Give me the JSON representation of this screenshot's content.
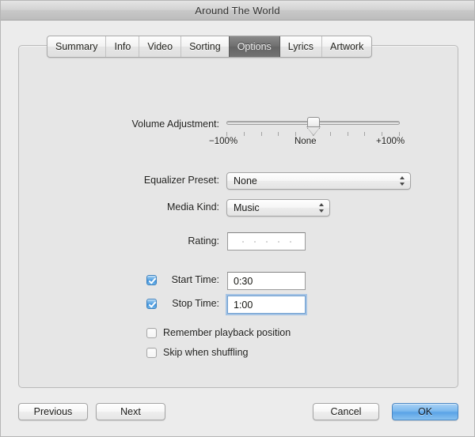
{
  "window": {
    "title": "Around The World"
  },
  "tabs": [
    {
      "label": "Summary",
      "selected": false
    },
    {
      "label": "Info",
      "selected": false
    },
    {
      "label": "Video",
      "selected": false
    },
    {
      "label": "Sorting",
      "selected": false
    },
    {
      "label": "Options",
      "selected": true
    },
    {
      "label": "Lyrics",
      "selected": false
    },
    {
      "label": "Artwork",
      "selected": false
    }
  ],
  "form": {
    "volume": {
      "label": "Volume Adjustment:",
      "value_label": "None",
      "min_label": "−100%",
      "max_label": "+100%",
      "position_percent": 50,
      "tick_count": 11
    },
    "equalizer": {
      "label": "Equalizer Preset:",
      "value": "None"
    },
    "media_kind": {
      "label": "Media Kind:",
      "value": "Music"
    },
    "rating": {
      "label": "Rating:",
      "stars_total": 5,
      "stars_filled": 0
    },
    "start_time": {
      "label": "Start Time:",
      "checked": true,
      "value": "0:30",
      "focused": false
    },
    "stop_time": {
      "label": "Stop Time:",
      "checked": true,
      "value": "1:00",
      "focused": true
    },
    "remember_position": {
      "label": "Remember playback position",
      "checked": false
    },
    "skip_shuffling": {
      "label": "Skip when shuffling",
      "checked": false
    }
  },
  "buttons": {
    "previous": "Previous",
    "next": "Next",
    "cancel": "Cancel",
    "ok": "OK"
  },
  "colors": {
    "accent_blue": "#5aa3e6",
    "window_bg": "#ececec",
    "panel_bg": "#e6e6e6",
    "selected_tab_bg": "#6e6e6e"
  }
}
